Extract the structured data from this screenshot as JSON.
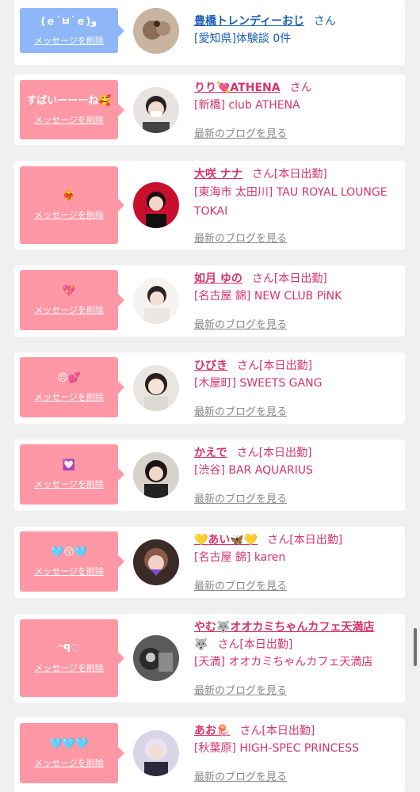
{
  "delete_label": "メッセージを削除",
  "blog_label": "最新のブログを見る",
  "san_label": "さん",
  "entries": [
    {
      "message": "(ｅ˙ㅂ˙ｅ)و",
      "name": "豊橋トレンディーおじ",
      "san": "さん",
      "shop": "[愛知県]体験談 0件",
      "blue": true
    },
    {
      "message": "すばいーーーね🥰",
      "name": "りり💘ATHENA",
      "san": "さん",
      "shop": "[新橋] club ATHENA"
    },
    {
      "message": "❤️‍🔥",
      "name": "大咲 ナナ",
      "san": "さん[本日出勤]",
      "shop": "[東海市 太田川] TAU ROYAL LOUNGE TOKAI"
    },
    {
      "message": "💖",
      "name": "如月 ゆの",
      "san": "さん[本日出勤]",
      "shop": "[名古屋 錦] NEW CLUB PiNK"
    },
    {
      "message": "😠💕",
      "name": "ひびき",
      "san": "さん[本日出勤]",
      "shop": "[木屋町] SWEETS GANG"
    },
    {
      "message": "💟",
      "name": "かえで",
      "san": "さん[本日出勤]",
      "shop": "[渋谷] BAR AQUARIUS"
    },
    {
      "message": "🩵😚🩵",
      "name": "💛あい🦋💛",
      "san": "さん[本日出勤]",
      "shop": "[名古屋 錦] karen"
    },
    {
      "message": "ᵔꟼ♡",
      "name": "やむ🐺オオカミちゃんカフェ天満店",
      "name2": "🐺",
      "san": "さん[本日出勤]",
      "shop": "[天満] オオカミちゃんカフェ天満店"
    },
    {
      "message": "🩵🩵🩵",
      "name": "あお🪼",
      "san": "さん[本日出勤]",
      "shop": "[秋葉原] HIGH-SPEC PRINCESS"
    }
  ]
}
